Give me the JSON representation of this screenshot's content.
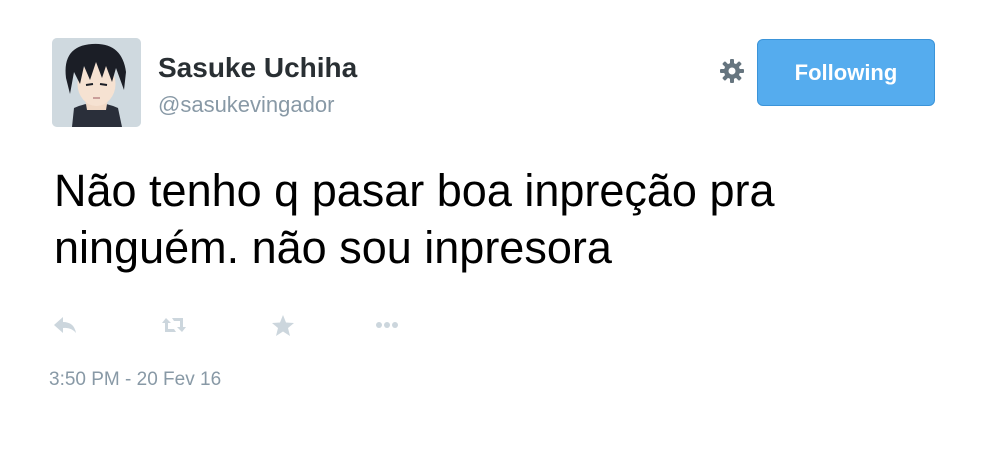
{
  "user": {
    "name": "Sasuke Uchiha",
    "handle": "@sasukevingador",
    "avatar_icon": "anime-character-avatar"
  },
  "header": {
    "settings_icon": "gear-icon",
    "follow_button_label": "Following"
  },
  "tweet": {
    "text": "Não tenho q pasar boa inpreção pra ninguém. não sou inpresora",
    "timestamp": "3:50 PM - 20 Fev 16"
  },
  "actions": [
    {
      "name": "reply",
      "icon": "reply-icon"
    },
    {
      "name": "retweet",
      "icon": "retweet-icon"
    },
    {
      "name": "favorite",
      "icon": "star-icon"
    },
    {
      "name": "more",
      "icon": "more-icon"
    }
  ],
  "colors": {
    "accent": "#55acee",
    "muted": "#8899a6",
    "icon": "#ccd6dd",
    "text": "#000000"
  }
}
